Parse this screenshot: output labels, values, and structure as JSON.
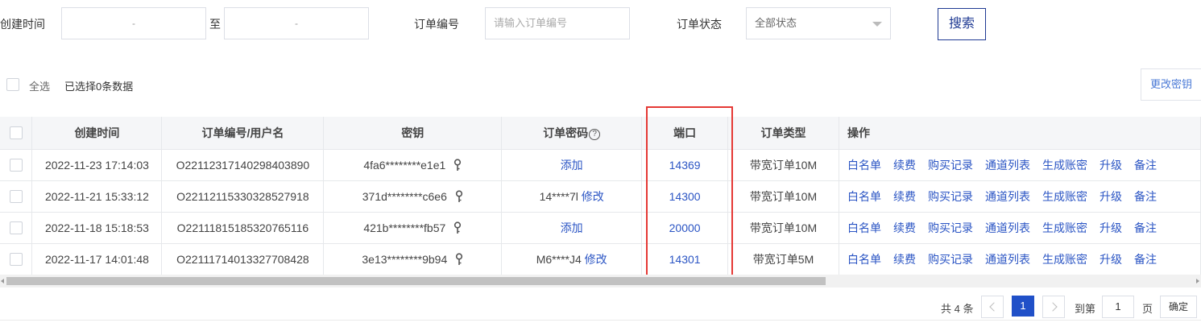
{
  "filters": {
    "created_label": "创建时间",
    "date_start_value": "-",
    "date_to": "至",
    "date_end_value": "-",
    "order_no_label": "订单编号",
    "order_no_placeholder": "请输入订单编号",
    "status_label": "订单状态",
    "status_value": "全部状态",
    "search_label": "搜索"
  },
  "selection": {
    "select_all_label": "全选",
    "selected_text": "已选择0条数据",
    "change_key_label": "更改密钥"
  },
  "table": {
    "columns": [
      "创建时间",
      "订单编号/用户名",
      "密钥",
      "订单密码",
      "端口",
      "订单类型",
      "操作"
    ],
    "help_icon_glyph": "?",
    "ops": [
      "白名单",
      "续费",
      "购买记录",
      "通道列表",
      "生成账密",
      "升级",
      "备注"
    ],
    "rows": [
      {
        "created": "2022-11-23 17:14:03",
        "order": "O22112317140298403890",
        "key": "4fa6********e1e1",
        "pwd_text": "",
        "pwd_link": "添加",
        "port": "14369",
        "type": "带宽订单10M"
      },
      {
        "created": "2022-11-21 15:33:12",
        "order": "O22112115330328527918",
        "key": "371d********c6e6",
        "pwd_text": "14****7l",
        "pwd_link": "修改",
        "port": "14300",
        "type": "带宽订单10M"
      },
      {
        "created": "2022-11-18 15:18:53",
        "order": "O22111815185320765116",
        "key": "421b********fb57",
        "pwd_text": "",
        "pwd_link": "添加",
        "port": "20000",
        "type": "带宽订单10M"
      },
      {
        "created": "2022-11-17 14:01:48",
        "order": "O22111714013327708428",
        "key": "3e13********9b94",
        "pwd_text": "M6****J4",
        "pwd_link": "修改",
        "port": "14301",
        "type": "带宽订单5M"
      }
    ]
  },
  "pagination": {
    "total_text": "共 4 条",
    "current_page": "1",
    "goto_label": "到第",
    "goto_value": "1",
    "page_suffix": "页",
    "confirm_label": "确定"
  },
  "colors": {
    "link": "#2b55c4",
    "highlight_border": "#e53935",
    "active_page": "#2050c8"
  },
  "icons": [
    "key-icon",
    "help-icon",
    "chevron-down-icon",
    "chevron-left-icon",
    "chevron-right-icon"
  ]
}
